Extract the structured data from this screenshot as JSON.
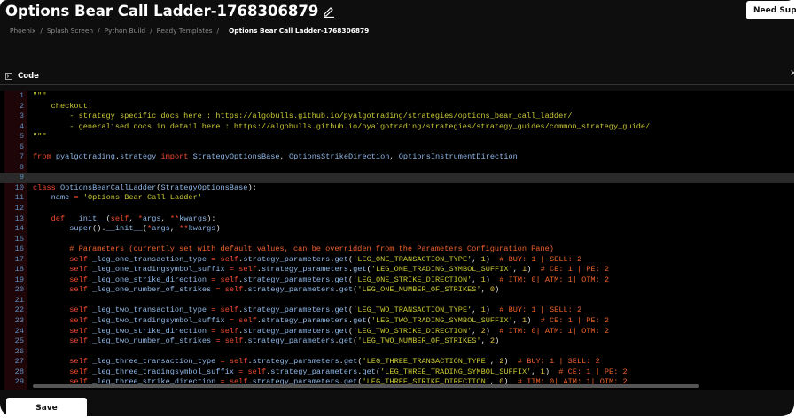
{
  "header": {
    "title": "Options Bear Call Ladder-1768306879",
    "edit_icon": "pencil-icon",
    "support_label": "Need Supp"
  },
  "breadcrumb": [
    "Phoenix",
    "Splash Screen",
    "Python Build",
    "Ready Templates"
  ],
  "breadcrumb_separator": "/",
  "breadcrumb_current": "Options Bear Call Ladder-1768306879",
  "tab": {
    "label": "Code",
    "icon": "terminal-icon"
  },
  "close_label": "×",
  "editor": {
    "active_line": 9,
    "lines": [
      "\"\"\"",
      "    checkout:",
      "        - strategy specific docs here : https://algobulls.github.io/pyalgotrading/strategies/options_bear_call_ladder/",
      "        - generalised docs in detail here : https://algobulls.github.io/pyalgotrading/strategies/strategy_guides/common_strategy_guide/",
      "\"\"\"",
      "",
      "from pyalgotrading.strategy import StrategyOptionsBase, OptionsStrikeDirection, OptionsInstrumentDirection",
      "",
      "",
      "class OptionsBearCallLadder(StrategyOptionsBase):",
      "    name = 'Options Bear Call Ladder'",
      "",
      "    def __init__(self, *args, **kwargs):",
      "        super().__init__(*args, **kwargs)",
      "",
      "        # Parameters (currently set with default values, can be overridden from the Parameters Configuration Pane)",
      "        self._leg_one_transaction_type = self.strategy_parameters.get('LEG_ONE_TRANSACTION_TYPE', 1)  # BUY: 1 | SELL: 2",
      "        self._leg_one_tradingsymbol_suffix = self.strategy_parameters.get('LEG_ONE_TRADING_SYMBOL_SUFFIX', 1)  # CE: 1 | PE: 2",
      "        self._leg_one_strike_direction = self.strategy_parameters.get('LEG_ONE_STRIKE_DIRECTION', 1)  # ITM: 0| ATM: 1| OTM: 2",
      "        self._leg_one_number_of_strikes = self.strategy_parameters.get('LEG_ONE_NUMBER_OF_STRIKES', 0)",
      "",
      "        self._leg_two_transaction_type = self.strategy_parameters.get('LEG_TWO_TRANSACTION_TYPE', 1)  # BUY: 1 | SELL: 2",
      "        self._leg_two_tradingsymbol_suffix = self.strategy_parameters.get('LEG_TWO_TRADING_SYMBOL_SUFFIX', 1)  # CE: 1 | PE: 2",
      "        self._leg_two_strike_direction = self.strategy_parameters.get('LEG_TWO_STRIKE_DIRECTION', 2)  # ITM: 0| ATM: 1| OTM: 2",
      "        self._leg_two_number_of_strikes = self.strategy_parameters.get('LEG_TWO_NUMBER_OF_STRIKES', 2)",
      "",
      "        self._leg_three_transaction_type = self.strategy_parameters.get('LEG_THREE_TRANSACTION_TYPE', 2)  # BUY: 1 | SELL: 2",
      "        self._leg_three_tradingsymbol_suffix = self.strategy_parameters.get('LEG_THREE_TRADING_SYMBOL_SUFFIX', 1)  # CE: 1 | PE: 2",
      "        self._leg_three_strike_direction = self.strategy_parameters.get('LEG_THREE_STRIKE_DIRECTION', 0)  # ITM: 0| ATM: 1| OTM: 2"
    ]
  },
  "footer": {
    "save_label": "Save"
  }
}
